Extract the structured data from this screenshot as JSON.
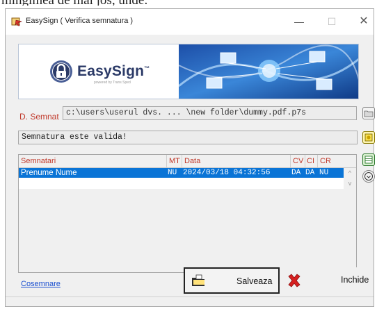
{
  "top_caption": "mingimea de mai jos, unde:",
  "window": {
    "title": "EasySign ( Verifica semnatura )",
    "controls": {
      "minimize": "—",
      "maximize": "☐",
      "close": "✕"
    }
  },
  "banner": {
    "logo_text": "EasySign",
    "logo_tm": "™",
    "logo_sub": "powered by Trans Sped"
  },
  "signed_file": {
    "label": "D. Semnat",
    "path": "c:\\users\\userul dvs. ... \\new folder\\dummy.pdf.p7s"
  },
  "status": {
    "text": "Semnatura este valida!"
  },
  "table": {
    "headers": [
      "Semnatari",
      "MT",
      "Data",
      "CV",
      "CI",
      "CR"
    ],
    "rows": [
      {
        "semnatari": "Prenume Nume",
        "mt": "NU",
        "data": "2024/03/18 04:32:56",
        "cv": "DA",
        "ci": "DA",
        "cr": "NU"
      }
    ]
  },
  "footer": {
    "cosemnare_link": "Cosemnare",
    "save_label": "Salveaza",
    "close_label": "Inchide"
  },
  "icons": {
    "folder": "folder-icon",
    "certificate": "certificate-icon",
    "spreadsheet": "spreadsheet-icon",
    "circle": "circle-arrow-icon",
    "save": "save-folder-icon",
    "close": "red-x-icon"
  },
  "colors": {
    "label_red": "#c0392b",
    "selection_blue": "#0a74d6",
    "link_blue": "#1a4fd0",
    "logo_navy": "#2b3a67",
    "close_red": "#d62020"
  }
}
